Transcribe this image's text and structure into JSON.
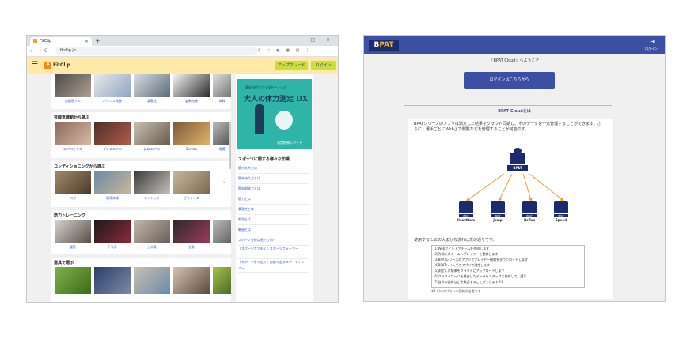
{
  "browser": {
    "tab_title": "FitClip",
    "tab_close": "×",
    "new_tab": "+",
    "window_controls": "– □ ×",
    "url": "fitclip.jp",
    "nav": {
      "back": "←",
      "forward": "→",
      "reload": "C",
      "home": "⌂"
    },
    "extensions": "⚲ ☆ ◐ ▣ ▤ ⋮"
  },
  "fitclip": {
    "menu_icon": "☰",
    "logo_mark": "F",
    "logo_text": "FitClip",
    "upgrade_label": "アップグレード",
    "login_label": "ログイン",
    "sections": [
      {
        "title": "",
        "items": [
          "自重筋トレ",
          "バランス改善",
          "柔軟性",
          "姿勢改善",
          "体幹"
        ]
      },
      {
        "title": "有酸素運動から選ぶ",
        "items": [
          "エアロビクス",
          "ダンスエアロ",
          "Jazzエアロ",
          "Zumba",
          "格闘"
        ]
      },
      {
        "title": "コンディショニングから選ぶ",
        "items": [
          "ヨガ",
          "健康体操",
          "ストレッチ",
          "ピラティス"
        ]
      },
      {
        "title": "筋力トレーニング",
        "items": [
          "腹筋",
          "下半身",
          "上半身",
          "全身",
          ""
        ]
      },
      {
        "title": "道具で選ぶ",
        "items": [
          "",
          "",
          "",
          "",
          ""
        ]
      }
    ],
    "ad": {
      "small_text": "最新技術でカラダをチェック",
      "big_text": "大人の体力測定 DX",
      "foot_text": "測定結果レポート"
    },
    "side_title": "スポーツに関する様々な知識",
    "side_links": [
      "筋持久力とは",
      "筋肉持久力とは",
      "筋肉瞬発力とは",
      "筋力とは",
      "柔軟性とは",
      "瞬発とは",
      "敏捷とは",
      "スポーツ分析は急たり前？",
      "【スポーツ言で走く】スポーツフォーマー",
      "【スポーツ言で走く】自前で走るスポーツトレーナー"
    ],
    "chevron": "›"
  },
  "bpat": {
    "logo_b": "B",
    "logo_rest": "PAT",
    "login_icon": "⇥",
    "login_label": "ログイン",
    "welcome": "「BPAT Cloud」へようこそ",
    "login_button": "ログインはこちらから",
    "about_title": "BPAT Cloudとは",
    "description": "BPATシリーズのアプリは測定した結果をクラウド同期し、そのデータを一元管理することができます。さらに、選手ごとにWeb上で閲覧などを管理することが可能です。",
    "center_tag": "BPAT",
    "modules": [
      {
        "tag": "BPAT",
        "name": "HeartRate"
      },
      {
        "tag": "BPAT",
        "name": "Jump"
      },
      {
        "tag": "BPAT",
        "name": "Reflex"
      },
      {
        "tag": "BPAT",
        "name": "Speed"
      }
    ],
    "flow_title": "使用するための大まかな流れは次の通りです。",
    "steps": [
      "(1)Webサイト上でチームを作成します",
      "(2)作成したチームへプレイヤーを登録します",
      "(3)BPATシリーズのアプリでプレイヤー情報をダウンロードします",
      "(4)BPATシリーズのアプリで測定します",
      "(5)測定した結果をクラウドにアップロードします",
      "(6)クラウドサーバを経由したデータをスタッフと共有して、選手",
      "(7)自分の記録などを確認することができます※1"
    ],
    "note": "※1 Cloudプランの契約が必要です"
  },
  "colors": {
    "fitclip_header": "#ffe9a8",
    "fitclip_button": "#cadf3f",
    "bpat_primary": "#3d4fa3",
    "bpat_dark": "#1c2a6e",
    "arrow": "#e8a03a"
  }
}
